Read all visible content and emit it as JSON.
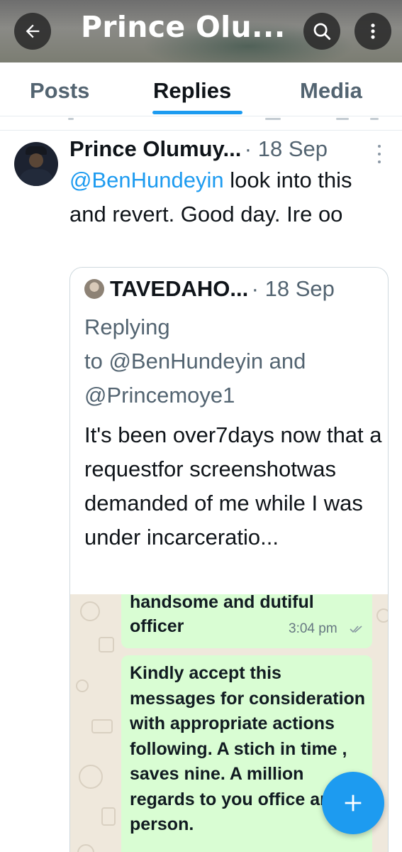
{
  "header": {
    "title": "Prince Olu...",
    "back_icon": "arrow-left-icon",
    "search_icon": "search-icon",
    "more_icon": "more-vertical-icon"
  },
  "tabs": [
    {
      "label": "Posts",
      "active": false
    },
    {
      "label": "Replies",
      "active": true
    },
    {
      "label": "Media",
      "active": false
    }
  ],
  "colors": {
    "accent": "#1d9bf0",
    "text_primary": "#0f1419",
    "text_secondary": "#536471",
    "chat_bubble": "#d9fdd3",
    "chat_background": "#efe8dc"
  },
  "tweet": {
    "author": "Prince Olumuy...",
    "separator": "·",
    "date": "18 Sep",
    "mention": "@BenHundeyin",
    "text_after_mention": " look into this and revert. Good day. Ire oo"
  },
  "quote": {
    "author": "TAVEDAHO...",
    "separator": "·",
    "date": "18 Sep",
    "replying_label": "Replying",
    "replying_to": "to @BenHundeyin and @Princemoye1",
    "text": "It's been over7days now that a requestfor screenshotwas demanded of me while I was under incarceratio..."
  },
  "chat_image": {
    "bubble_1_text": "handsome and dutiful officer",
    "bubble_1_time": "3:04 pm",
    "bubble_2_text": "Kindly accept this messages for consideration with appropriate actions following.  A stich in time , saves nine.   A million regards to you office and person."
  },
  "fab": {
    "icon": "plus-icon"
  }
}
